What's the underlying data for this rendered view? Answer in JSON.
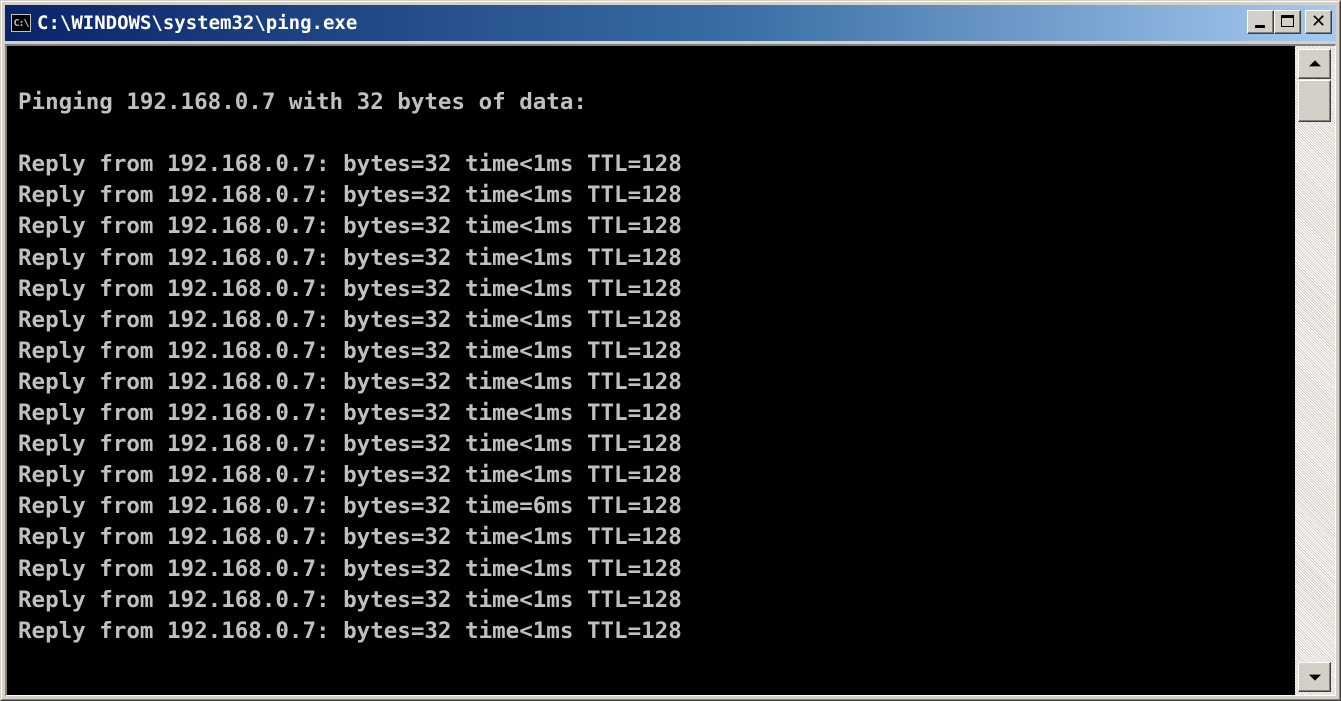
{
  "window": {
    "title": "C:\\WINDOWS\\system32\\ping.exe",
    "icon_text": "C:\\",
    "icon": "console-icon"
  },
  "title_buttons": {
    "minimize_icon": "minimize-icon",
    "maximize_icon": "maximize-icon",
    "close_icon": "close-icon",
    "close_glyph": "✕"
  },
  "console": {
    "text_color": "#c0c0c0",
    "background": "#000000",
    "lines": [
      "",
      "Pinging 192.168.0.7 with 32 bytes of data:",
      "",
      "Reply from 192.168.0.7: bytes=32 time<1ms TTL=128",
      "Reply from 192.168.0.7: bytes=32 time<1ms TTL=128",
      "Reply from 192.168.0.7: bytes=32 time<1ms TTL=128",
      "Reply from 192.168.0.7: bytes=32 time<1ms TTL=128",
      "Reply from 192.168.0.7: bytes=32 time<1ms TTL=128",
      "Reply from 192.168.0.7: bytes=32 time<1ms TTL=128",
      "Reply from 192.168.0.7: bytes=32 time<1ms TTL=128",
      "Reply from 192.168.0.7: bytes=32 time<1ms TTL=128",
      "Reply from 192.168.0.7: bytes=32 time<1ms TTL=128",
      "Reply from 192.168.0.7: bytes=32 time<1ms TTL=128",
      "Reply from 192.168.0.7: bytes=32 time<1ms TTL=128",
      "Reply from 192.168.0.7: bytes=32 time=6ms TTL=128",
      "Reply from 192.168.0.7: bytes=32 time<1ms TTL=128",
      "Reply from 192.168.0.7: bytes=32 time<1ms TTL=128",
      "Reply from 192.168.0.7: bytes=32 time<1ms TTL=128",
      "Reply from 192.168.0.7: bytes=32 time<1ms TTL=128"
    ]
  },
  "scrollbar": {
    "up_icon": "scroll-up-arrow-icon",
    "down_icon": "scroll-down-arrow-icon",
    "position_fraction": 0.0
  }
}
